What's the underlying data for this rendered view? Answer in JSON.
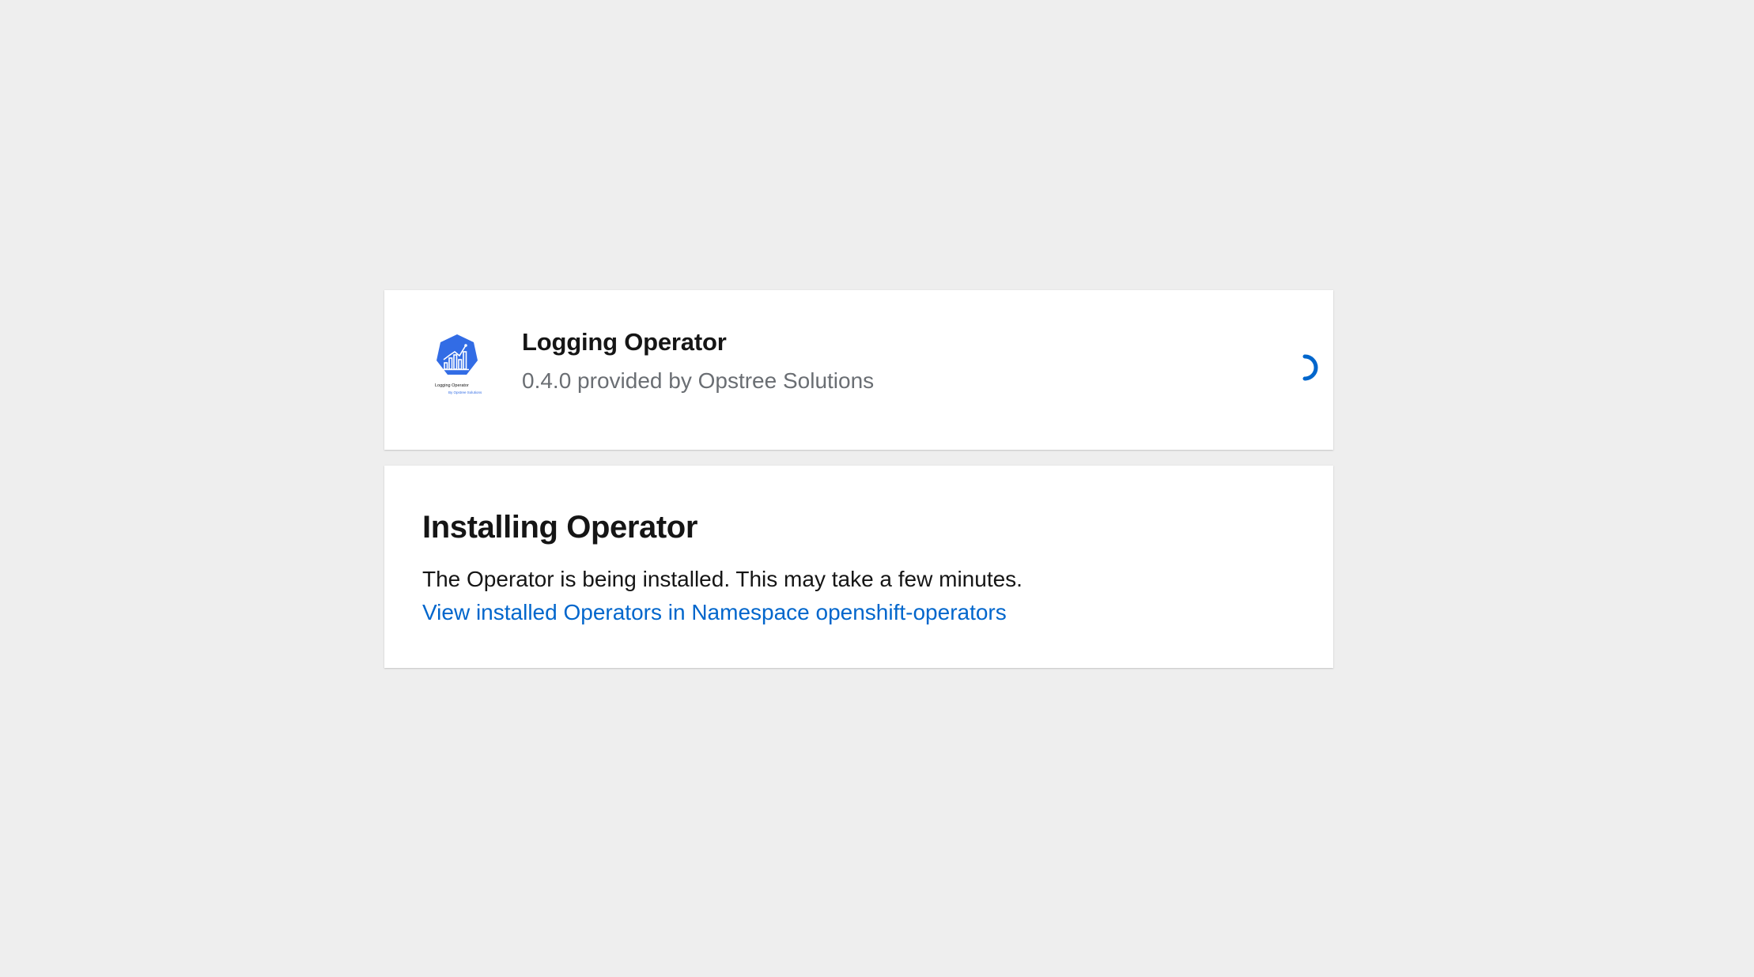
{
  "operator": {
    "name": "Logging Operator",
    "provider_line": "0.4.0 provided by Opstree Solutions",
    "logo_caption": "Logging Operator",
    "logo_subcaption": "By Opstree Solutions",
    "logo_icon": "kubernetes-bar-chart-logo"
  },
  "install": {
    "title": "Installing Operator",
    "description": "The Operator is being installed. This may take a few minutes.",
    "link_label": "View installed Operators in Namespace openshift-operators"
  },
  "colors": {
    "background": "#eeeeee",
    "card": "#ffffff",
    "link": "#0066cc",
    "spinner": "#0066cc",
    "logo_blue": "#326ce5",
    "muted_text": "#6a6e73"
  },
  "spinner": {
    "icon": "loading-spinner-icon",
    "state": "loading"
  }
}
